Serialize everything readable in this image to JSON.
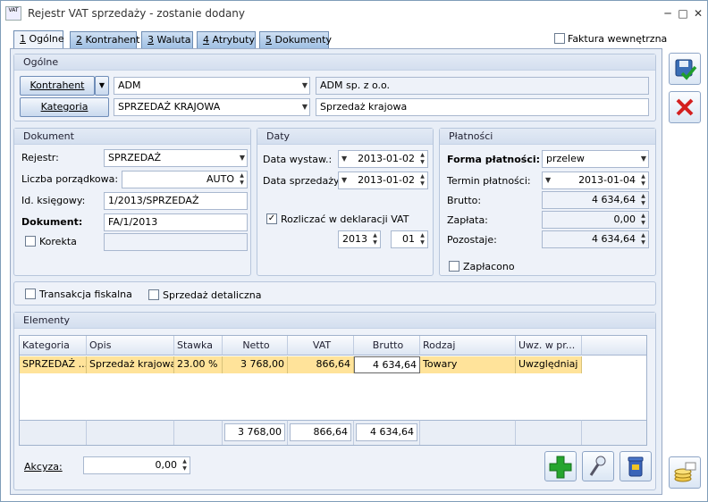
{
  "window": {
    "title": "Rejestr VAT sprzedaży - zostanie dodany",
    "icon_text": "VAT"
  },
  "tabs": [
    {
      "key": "1",
      "label": " Ogólne"
    },
    {
      "key": "2",
      "label": " Kontrahent"
    },
    {
      "key": "3",
      "label": " Waluta"
    },
    {
      "key": "4",
      "label": " Atrybuty"
    },
    {
      "key": "5",
      "label": " Dokumenty"
    }
  ],
  "faktura_wewnetrzna": {
    "label": "Faktura wewnętrzna",
    "checked": false
  },
  "ogolne": {
    "title": "Ogólne",
    "kontrahent_button": "Kontrahent",
    "kontrahent_code": "ADM",
    "kontrahent_name": "ADM sp. z o.o.",
    "kategoria_button": "Kategoria",
    "kategoria_code": "SPRZEDAŻ KRAJOWA",
    "kategoria_desc": "Sprzedaż krajowa"
  },
  "dokument": {
    "title": "Dokument",
    "rejestr_label": "Rejestr:",
    "rejestr_value": "SPRZEDAŻ",
    "lp_label": "Liczba porządkowa:",
    "lp_value": "AUTO",
    "id_label": "Id. księgowy:",
    "id_value": "1/2013/SPRZEDAŻ",
    "dok_label": "Dokument:",
    "dok_value": "FA/1/2013",
    "korekta_label": "Korekta",
    "korekta_value": ""
  },
  "daty": {
    "title": "Daty",
    "wystaw_label": "Data wystaw.:",
    "wystaw_value": "2013-01-02",
    "sprzedazy_label": "Data sprzedaży:",
    "sprzedazy_value": "2013-01-02",
    "rozliczac_label": "Rozliczać w deklaracji VAT",
    "rozliczac_checked": true,
    "rok": "2013",
    "miesiac": "01"
  },
  "platnosci": {
    "title": "Płatności",
    "forma_label": "Forma płatności:",
    "forma_value": "przelew",
    "termin_label": "Termin płatności:",
    "termin_value": "2013-01-04",
    "brutto_label": "Brutto:",
    "brutto_value": "4 634,64",
    "zaplata_label": "Zapłata:",
    "zaplata_value": "0,00",
    "pozostaje_label": "Pozostaje:",
    "pozostaje_value": "4 634,64",
    "zaplacono_label": "Zapłacono"
  },
  "options": {
    "fiskalna_label": "Transakcja fiskalna",
    "detaliczna_label": "Sprzedaż detaliczna"
  },
  "elementy": {
    "title": "Elementy",
    "columns": [
      "Kategoria",
      "Opis",
      "Stawka",
      "Netto",
      "VAT",
      "Brutto",
      "Rodzaj",
      "Uwz. w pr..."
    ],
    "rows": [
      [
        "SPRZEDAŻ ...",
        "Sprzedaż krajowa",
        "23.00 %",
        "3 768,00",
        "866,64",
        "4 634,64",
        "Towary",
        "Uwzględniaj"
      ]
    ],
    "sums": {
      "netto": "3 768,00",
      "vat": "866,64",
      "brutto": "4 634,64"
    }
  },
  "akcyza": {
    "label": "Akcyza:",
    "value": "0,00"
  }
}
